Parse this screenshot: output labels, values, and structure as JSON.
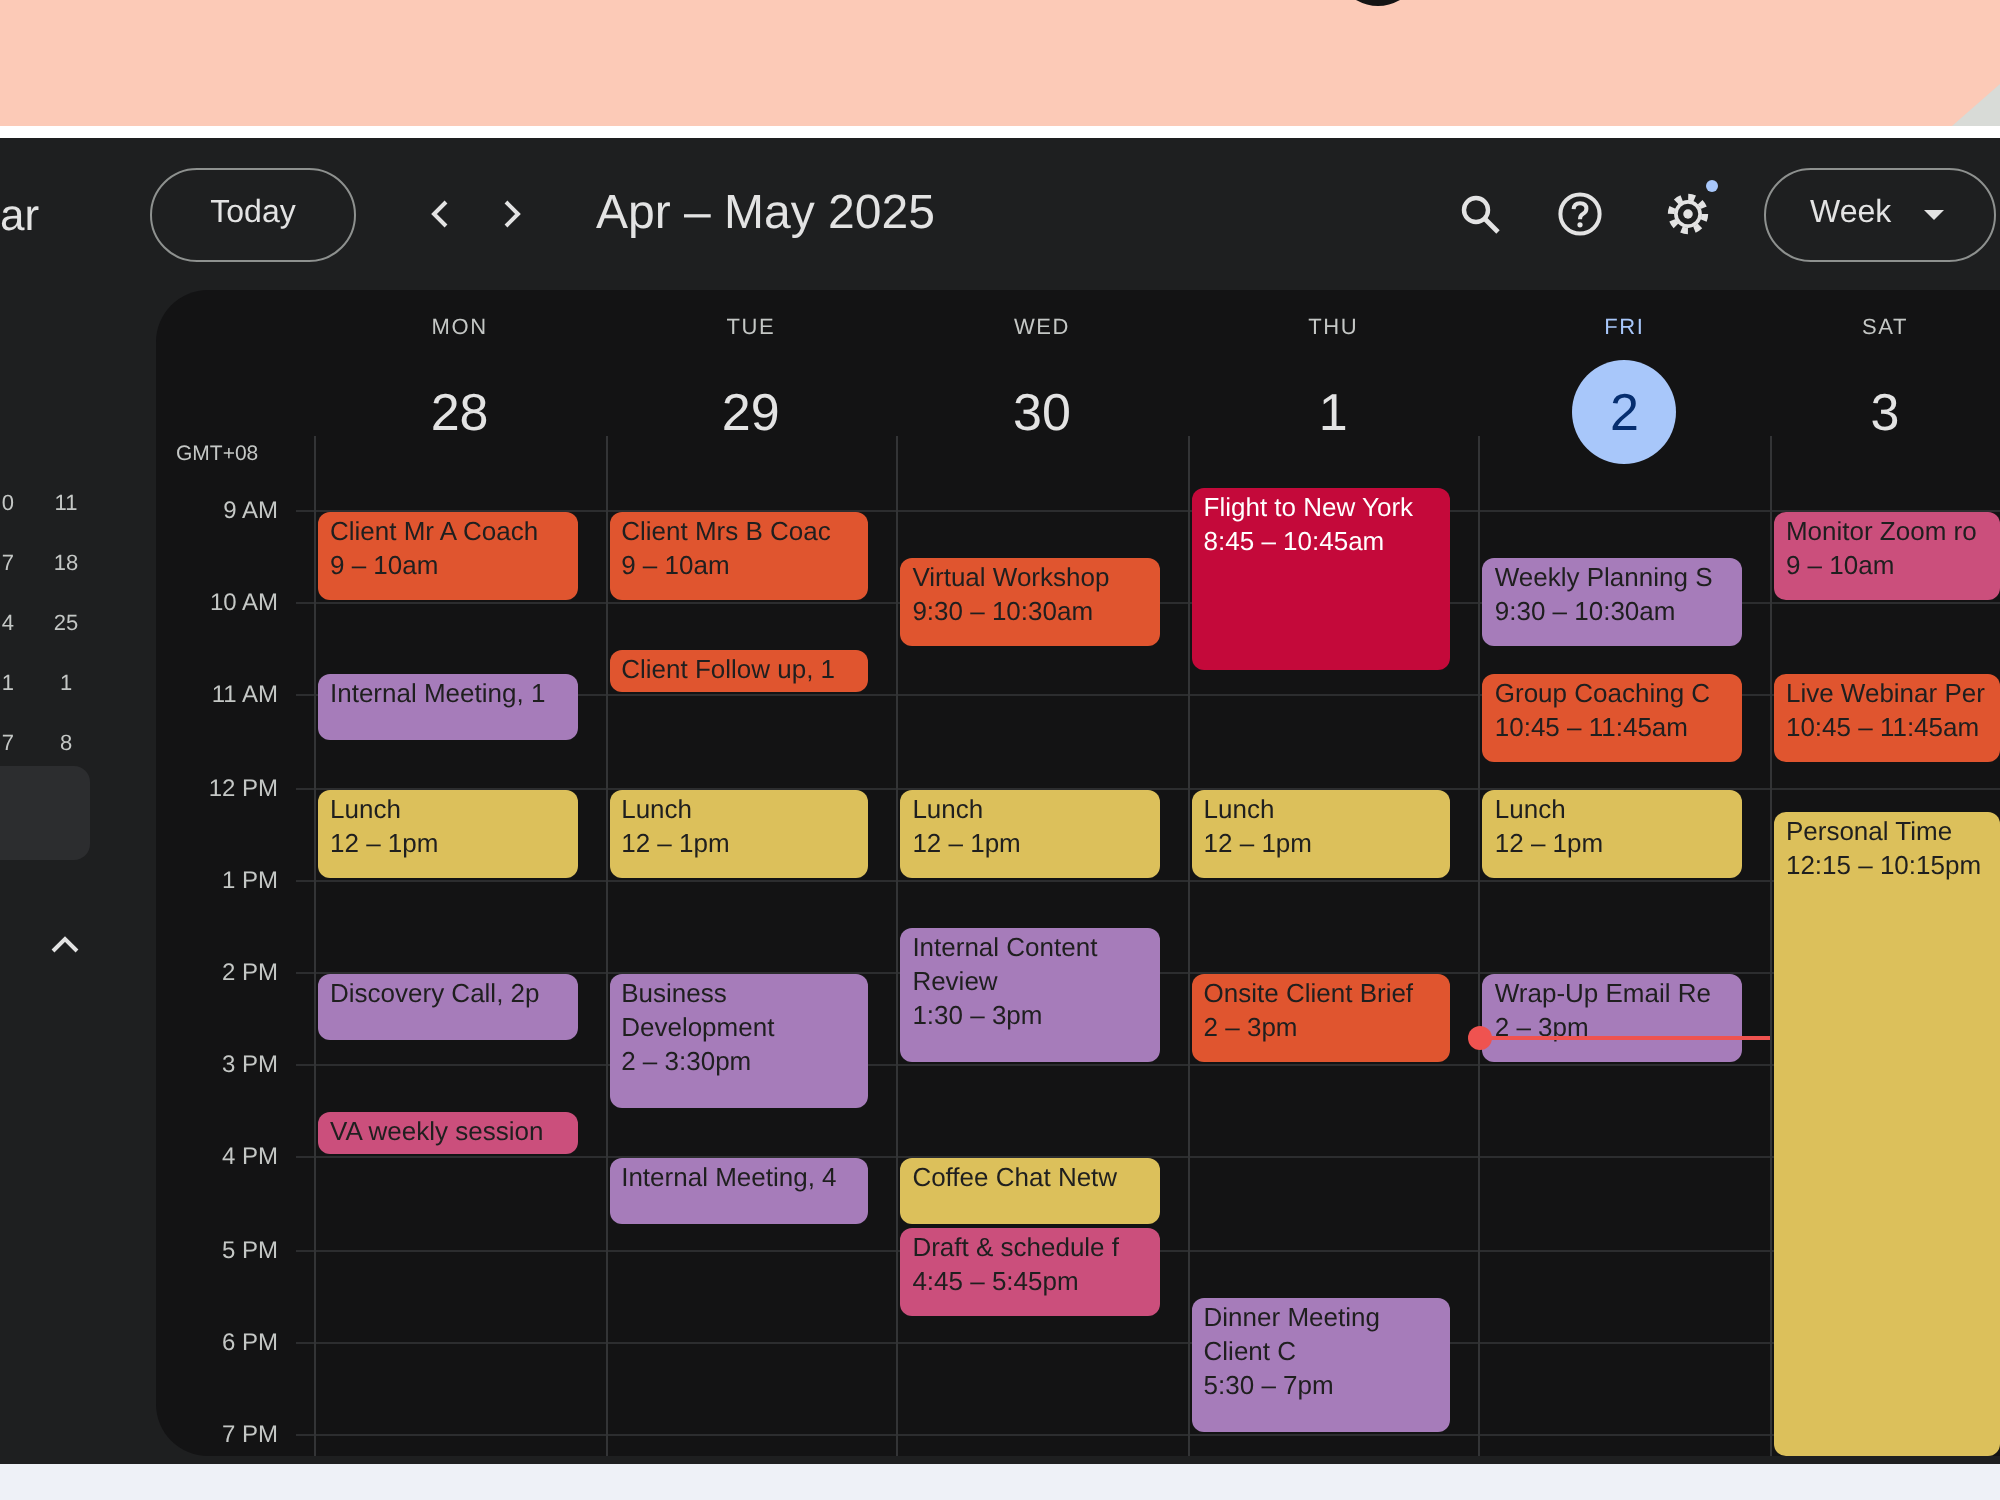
{
  "sidebar": {
    "title": "ar",
    "mini_calendar": [
      [
        "0",
        "11"
      ],
      [
        "7",
        "18"
      ],
      [
        "4",
        "25"
      ],
      [
        "1",
        "1"
      ],
      [
        "7",
        "8"
      ]
    ]
  },
  "toolbar": {
    "today_button": "Today",
    "date_range": "Apr – May 2025",
    "settings_badge": true,
    "view_button": "Week"
  },
  "calendar": {
    "timezone": "GMT+08",
    "time_labels": [
      "9 AM",
      "10 AM",
      "11 AM",
      "12 PM",
      "1 PM",
      "2 PM",
      "3 PM",
      "4 PM",
      "5 PM",
      "6 PM",
      "7 PM"
    ],
    "days": [
      {
        "name": "MON",
        "date": "28",
        "today": false,
        "events": [
          {
            "title": "Client Mr A Coach",
            "time": "9 – 10am",
            "color": "#e0552f"
          },
          {
            "title": "Internal Meeting, 1",
            "color": "#a67cba"
          },
          {
            "title": "Lunch",
            "time": "12 – 1pm",
            "color": "#dcc05b"
          },
          {
            "title": "Discovery Call, 2p",
            "color": "#a67cba"
          },
          {
            "title": "VA weekly session",
            "color": "#cb4f7c"
          }
        ]
      },
      {
        "name": "TUE",
        "date": "29",
        "today": false,
        "events": [
          {
            "title": "Client Mrs B Coac",
            "time": "9 – 10am",
            "color": "#e0552f"
          },
          {
            "title": "Client Follow up, 1",
            "color": "#e0552f"
          },
          {
            "title": "Lunch",
            "time": "12 – 1pm",
            "color": "#dcc05b"
          },
          {
            "title": "Business Development",
            "time": "2 – 3:30pm",
            "color": "#a67cba"
          },
          {
            "title": "Internal Meeting, 4",
            "color": "#a67cba"
          }
        ]
      },
      {
        "name": "WED",
        "date": "30",
        "today": false,
        "events": [
          {
            "title": "Virtual Workshop",
            "time": "9:30 – 10:30am",
            "color": "#e0552f"
          },
          {
            "title": "Lunch",
            "time": "12 – 1pm",
            "color": "#dcc05b"
          },
          {
            "title": "Internal Content Review",
            "time": "1:30 – 3pm",
            "color": "#a67cba"
          },
          {
            "title": "Coffee Chat Netw",
            "color": "#dcc05b"
          },
          {
            "title": "Draft & schedule f",
            "time": "4:45 – 5:45pm",
            "color": "#cb4f7c"
          }
        ]
      },
      {
        "name": "THU",
        "date": "1",
        "today": false,
        "events": [
          {
            "title": "Flight to New York",
            "time": "8:45 – 10:45am",
            "color": "#c4093a"
          },
          {
            "title": "Lunch",
            "time": "12 – 1pm",
            "color": "#dcc05b"
          },
          {
            "title": "Onsite Client Brief",
            "time": "2 – 3pm",
            "color": "#e0552f"
          },
          {
            "title": "Dinner Meeting Client C",
            "time": "5:30 – 7pm",
            "color": "#a67cba"
          }
        ]
      },
      {
        "name": "FRI",
        "date": "2",
        "today": true,
        "current_time_line": true,
        "events": [
          {
            "title": "Weekly Planning S",
            "time": "9:30 – 10:30am",
            "color": "#a67cba"
          },
          {
            "title": "Group Coaching C",
            "time": "10:45 – 11:45am",
            "color": "#e0552f"
          },
          {
            "title": "Lunch",
            "time": "12 – 1pm",
            "color": "#dcc05b"
          },
          {
            "title": "Wrap-Up Email Re",
            "time": "2 – 3pm",
            "color": "#a67cba"
          }
        ]
      },
      {
        "name": "SAT",
        "date": "3",
        "today": false,
        "events": [
          {
            "title": "Monitor Zoom ro",
            "time": "9 – 10am",
            "color": "#cb4f7c"
          },
          {
            "title": "Live Webinar Per",
            "time": "10:45 – 11:45am",
            "color": "#e0552f"
          },
          {
            "title": "Personal Time",
            "time": "12:15 – 10:15pm",
            "color": "#dcc05b"
          }
        ]
      }
    ]
  }
}
